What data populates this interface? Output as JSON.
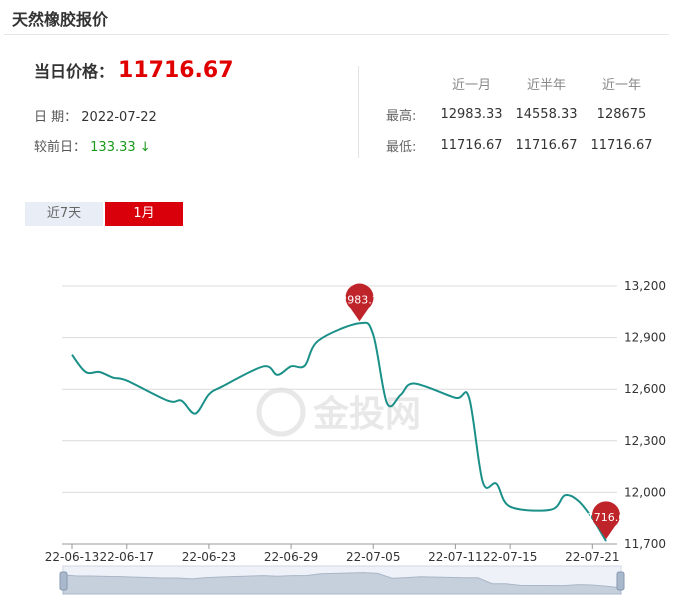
{
  "header": {
    "title": "天然橡胶报价"
  },
  "price": {
    "label": "当日价格：",
    "value": "11716.67"
  },
  "date": {
    "label": "日 期：",
    "value": "2022-07-22"
  },
  "change": {
    "label": "较前日：",
    "value": "133.33",
    "arrow": "↓"
  },
  "stats": {
    "headers": [
      "近一月",
      "近半年",
      "近一年"
    ],
    "rows": [
      {
        "label": "最高:",
        "values": [
          "12983.33",
          "14558.33",
          "128675"
        ]
      },
      {
        "label": "最低:",
        "values": [
          "11716.67",
          "11716.67",
          "11716.67"
        ]
      }
    ]
  },
  "tabs": [
    {
      "label": "近7天",
      "active": false
    },
    {
      "label": "1月",
      "active": true
    }
  ],
  "watermark": "金投网",
  "chart_data": {
    "type": "line",
    "x_tick_labels": [
      "22-06-13",
      "22-06-17",
      "22-06-23",
      "22-06-29",
      "22-07-05",
      "22-07-11",
      "22-07-15",
      "22-07-21"
    ],
    "y_tick_labels": [
      "13,200",
      "12,900",
      "12,600",
      "12,300",
      "12,000",
      "11,700"
    ],
    "ylim": [
      11700,
      13200
    ],
    "points": [
      [
        "22-06-13",
        12800
      ],
      [
        "22-06-14",
        12700
      ],
      [
        "22-06-15",
        12700
      ],
      [
        "22-06-16",
        12667
      ],
      [
        "22-06-17",
        12650
      ],
      [
        "22-06-20",
        12533
      ],
      [
        "22-06-21",
        12533
      ],
      [
        "22-06-22",
        12458
      ],
      [
        "22-06-23",
        12570
      ],
      [
        "22-06-24",
        12617
      ],
      [
        "22-06-27",
        12733
      ],
      [
        "22-06-28",
        12683
      ],
      [
        "22-06-29",
        12733
      ],
      [
        "22-06-30",
        12737
      ],
      [
        "22-07-01",
        12883
      ],
      [
        "22-07-04",
        12983.33
      ],
      [
        "22-07-05",
        12917
      ],
      [
        "22-07-06",
        12520
      ],
      [
        "22-07-07",
        12567
      ],
      [
        "22-07-08",
        12633
      ],
      [
        "22-07-11",
        12550
      ],
      [
        "22-07-12",
        12550
      ],
      [
        "22-07-13",
        12060
      ],
      [
        "22-07-14",
        12050
      ],
      [
        "22-07-15",
        11917
      ],
      [
        "22-07-18",
        11900
      ],
      [
        "22-07-19",
        11983
      ],
      [
        "22-07-20",
        11950
      ],
      [
        "22-07-21",
        11850
      ],
      [
        "22-07-22",
        11716.67
      ]
    ],
    "marker_high": "12983.33",
    "marker_last": "11716.67",
    "line_color": "#1a9088",
    "marker_color": "#c0242b",
    "grid": true
  }
}
